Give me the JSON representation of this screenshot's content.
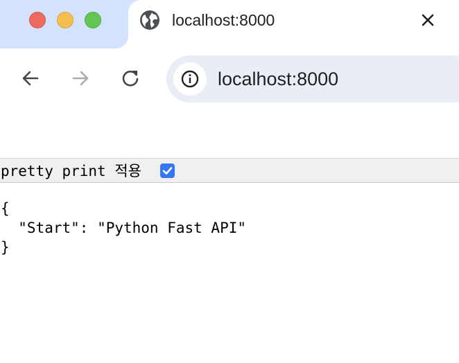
{
  "window": {
    "traffic_lights": [
      "close",
      "minimize",
      "maximize"
    ]
  },
  "tab": {
    "title": "localhost:8000",
    "icon": "globe-icon",
    "close_icon": "close-icon"
  },
  "toolbar": {
    "back_icon": "arrow-left-icon",
    "forward_icon": "arrow-right-icon",
    "reload_icon": "reload-icon",
    "site_info_icon": "info-icon",
    "url": "localhost:8000"
  },
  "page": {
    "pretty_print_label": "pretty print 적용",
    "pretty_print_checked": true,
    "json_lines": [
      "{",
      "  \"Start\": \"Python Fast API\"",
      "}"
    ]
  },
  "colors": {
    "tabstrip": "#d3e3fd",
    "omnibox": "#e9eef6",
    "checkbox": "#3478f6"
  }
}
